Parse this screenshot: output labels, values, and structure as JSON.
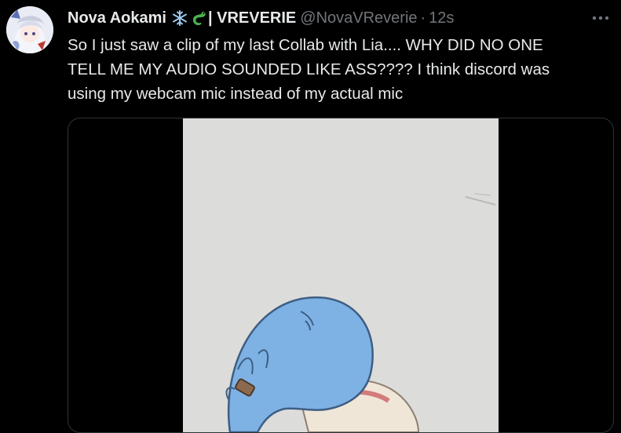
{
  "tweet": {
    "author": {
      "display_name": "Nova Aokami",
      "name_emojis": [
        "snowflake-icon",
        "dragon-icon"
      ],
      "brand_suffix": "| VREVERIE",
      "handle": "@NovaVReverie",
      "separator": "·",
      "timestamp": "12s"
    },
    "more_icon": "ellipsis-icon",
    "text_lines": [
      "So I just saw a clip of my last Collab with Lia.... WHY DID NO ONE",
      "TELL ME MY AUDIO SOUNDED LIKE ASS???? I think discord was",
      "using my webcam mic instead of my actual mic"
    ],
    "media": {
      "kind": "video-thumbnail"
    }
  },
  "colors": {
    "background": "#000000",
    "primary_text": "#e7e9ea",
    "secondary_text": "#71767b",
    "border": "#2f3336",
    "snowflake": "#9cc8ee",
    "dragon": "#4caf50"
  }
}
